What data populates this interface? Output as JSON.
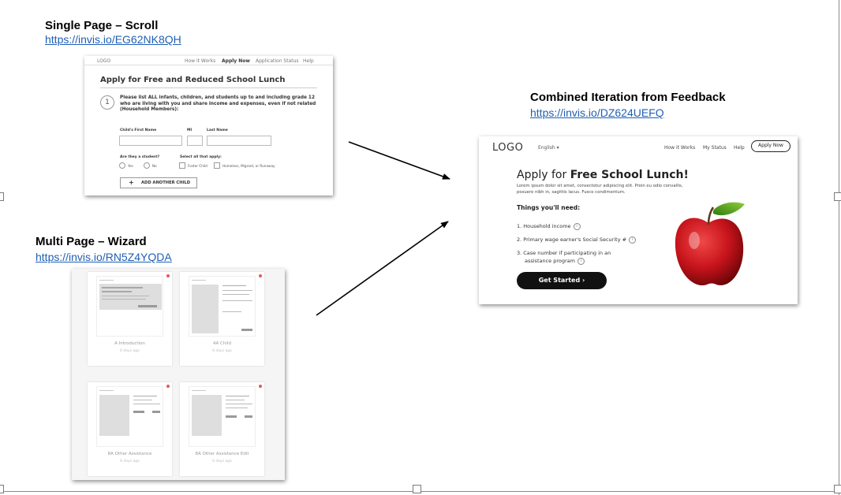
{
  "sections": {
    "single_page": {
      "heading": "Single Page – Scroll",
      "link": "https://invis.io/EG62NK8QH"
    },
    "multi_page": {
      "heading": "Multi Page – Wizard",
      "link": "https://invis.io/RN5Z4YQDA"
    },
    "combined": {
      "heading": "Combined Iteration from Feedback",
      "link": "https://invis.io/DZ624UEFQ"
    }
  },
  "single_page_mockup": {
    "logo": "LOGO",
    "nav": [
      "How it Works",
      "Apply Now",
      "Application Status",
      "Help"
    ],
    "title": "Apply for Free and Reduced School Lunch",
    "step_number": "1",
    "question": "Please list ALL infants, children, and students up to and including grade 12 who are living with you and share income and expenses, even if not related (Household Members):",
    "field_labels": {
      "first_name": "Child's First Name",
      "mi": "MI",
      "last_name": "Last Name"
    },
    "student_question": "Are they a student?",
    "student_options": [
      "Yes",
      "No"
    ],
    "select_all": "Select all that apply:",
    "checkbox_options": [
      "Foster Child",
      "Homeless, Migrant, or Runaway"
    ],
    "add_button": "ADD ANOTHER CHILD",
    "add_symbol": "+"
  },
  "multi_page_mockup": {
    "cards": [
      {
        "name": "A Introduction",
        "time": "6 days ago"
      },
      {
        "name": "4A Child",
        "time": "6 days ago"
      },
      {
        "name": "8A Other Assistance",
        "time": "6 days ago"
      },
      {
        "name": "8A Other Assistance Edit",
        "time": "6 days ago"
      }
    ]
  },
  "combined_mockup": {
    "logo": "LOGO",
    "language": "English ▾",
    "nav": [
      "How it Works",
      "My Status",
      "Help"
    ],
    "apply_button": "Apply Now",
    "title_prefix": "Apply for ",
    "title_bold": "Free School Lunch!",
    "lorem": "Lorem ipsum dolor sit amet, consectetur adipiscing elit. Proin eu odio convallis, posuere nibh in, sagittis lacus. Fusce condimentum.",
    "needs_heading": "Things you'll need:",
    "needs": [
      "1. Household income",
      "2. Primary wage earner's Social Security #",
      "3. Case number if participating in an",
      "assistance program"
    ],
    "info_glyph": "i",
    "cta": "Get Started  ›"
  },
  "colors": {
    "link": "#1f5fb5",
    "apple_red": "#c8141c",
    "leaf_green": "#4a9a1e"
  }
}
